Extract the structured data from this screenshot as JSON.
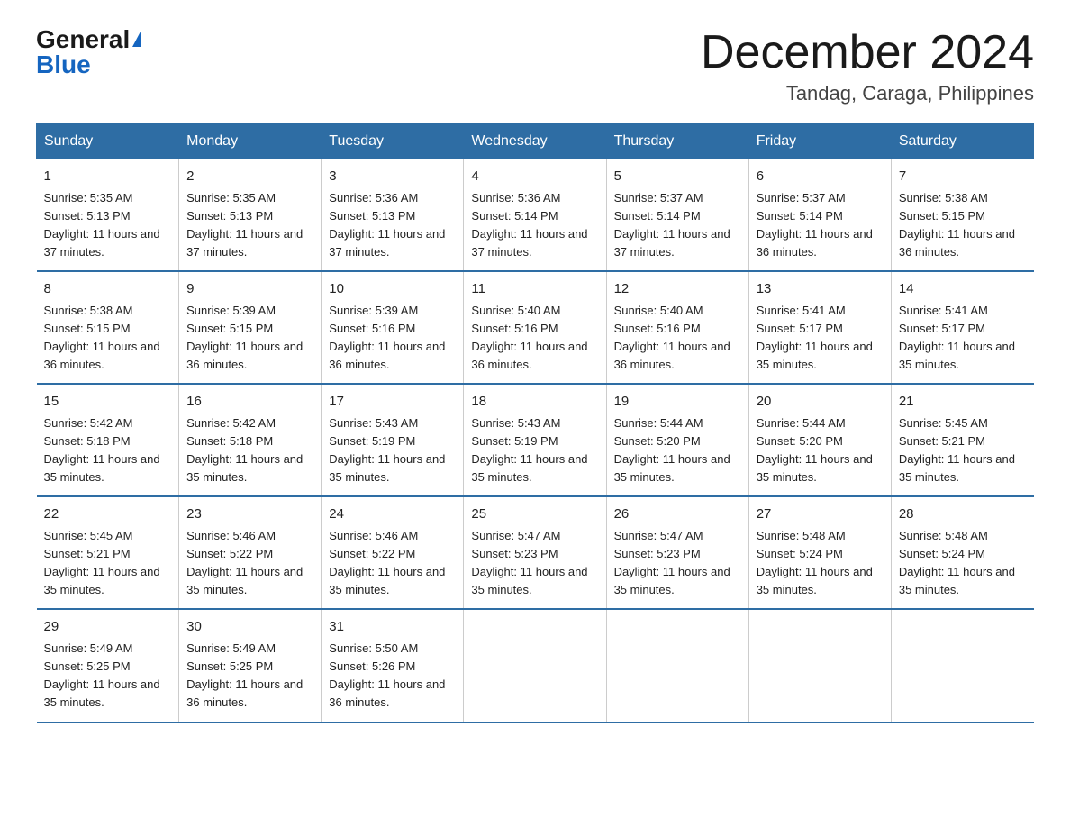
{
  "logo": {
    "text_general": "General",
    "text_blue": "Blue",
    "triangle": "▶"
  },
  "title": {
    "month_year": "December 2024",
    "location": "Tandag, Caraga, Philippines"
  },
  "weekdays": [
    "Sunday",
    "Monday",
    "Tuesday",
    "Wednesday",
    "Thursday",
    "Friday",
    "Saturday"
  ],
  "weeks": [
    [
      {
        "day": "1",
        "sunrise": "5:35 AM",
        "sunset": "5:13 PM",
        "daylight": "11 hours and 37 minutes."
      },
      {
        "day": "2",
        "sunrise": "5:35 AM",
        "sunset": "5:13 PM",
        "daylight": "11 hours and 37 minutes."
      },
      {
        "day": "3",
        "sunrise": "5:36 AM",
        "sunset": "5:13 PM",
        "daylight": "11 hours and 37 minutes."
      },
      {
        "day": "4",
        "sunrise": "5:36 AM",
        "sunset": "5:14 PM",
        "daylight": "11 hours and 37 minutes."
      },
      {
        "day": "5",
        "sunrise": "5:37 AM",
        "sunset": "5:14 PM",
        "daylight": "11 hours and 37 minutes."
      },
      {
        "day": "6",
        "sunrise": "5:37 AM",
        "sunset": "5:14 PM",
        "daylight": "11 hours and 36 minutes."
      },
      {
        "day": "7",
        "sunrise": "5:38 AM",
        "sunset": "5:15 PM",
        "daylight": "11 hours and 36 minutes."
      }
    ],
    [
      {
        "day": "8",
        "sunrise": "5:38 AM",
        "sunset": "5:15 PM",
        "daylight": "11 hours and 36 minutes."
      },
      {
        "day": "9",
        "sunrise": "5:39 AM",
        "sunset": "5:15 PM",
        "daylight": "11 hours and 36 minutes."
      },
      {
        "day": "10",
        "sunrise": "5:39 AM",
        "sunset": "5:16 PM",
        "daylight": "11 hours and 36 minutes."
      },
      {
        "day": "11",
        "sunrise": "5:40 AM",
        "sunset": "5:16 PM",
        "daylight": "11 hours and 36 minutes."
      },
      {
        "day": "12",
        "sunrise": "5:40 AM",
        "sunset": "5:16 PM",
        "daylight": "11 hours and 36 minutes."
      },
      {
        "day": "13",
        "sunrise": "5:41 AM",
        "sunset": "5:17 PM",
        "daylight": "11 hours and 35 minutes."
      },
      {
        "day": "14",
        "sunrise": "5:41 AM",
        "sunset": "5:17 PM",
        "daylight": "11 hours and 35 minutes."
      }
    ],
    [
      {
        "day": "15",
        "sunrise": "5:42 AM",
        "sunset": "5:18 PM",
        "daylight": "11 hours and 35 minutes."
      },
      {
        "day": "16",
        "sunrise": "5:42 AM",
        "sunset": "5:18 PM",
        "daylight": "11 hours and 35 minutes."
      },
      {
        "day": "17",
        "sunrise": "5:43 AM",
        "sunset": "5:19 PM",
        "daylight": "11 hours and 35 minutes."
      },
      {
        "day": "18",
        "sunrise": "5:43 AM",
        "sunset": "5:19 PM",
        "daylight": "11 hours and 35 minutes."
      },
      {
        "day": "19",
        "sunrise": "5:44 AM",
        "sunset": "5:20 PM",
        "daylight": "11 hours and 35 minutes."
      },
      {
        "day": "20",
        "sunrise": "5:44 AM",
        "sunset": "5:20 PM",
        "daylight": "11 hours and 35 minutes."
      },
      {
        "day": "21",
        "sunrise": "5:45 AM",
        "sunset": "5:21 PM",
        "daylight": "11 hours and 35 minutes."
      }
    ],
    [
      {
        "day": "22",
        "sunrise": "5:45 AM",
        "sunset": "5:21 PM",
        "daylight": "11 hours and 35 minutes."
      },
      {
        "day": "23",
        "sunrise": "5:46 AM",
        "sunset": "5:22 PM",
        "daylight": "11 hours and 35 minutes."
      },
      {
        "day": "24",
        "sunrise": "5:46 AM",
        "sunset": "5:22 PM",
        "daylight": "11 hours and 35 minutes."
      },
      {
        "day": "25",
        "sunrise": "5:47 AM",
        "sunset": "5:23 PM",
        "daylight": "11 hours and 35 minutes."
      },
      {
        "day": "26",
        "sunrise": "5:47 AM",
        "sunset": "5:23 PM",
        "daylight": "11 hours and 35 minutes."
      },
      {
        "day": "27",
        "sunrise": "5:48 AM",
        "sunset": "5:24 PM",
        "daylight": "11 hours and 35 minutes."
      },
      {
        "day": "28",
        "sunrise": "5:48 AM",
        "sunset": "5:24 PM",
        "daylight": "11 hours and 35 minutes."
      }
    ],
    [
      {
        "day": "29",
        "sunrise": "5:49 AM",
        "sunset": "5:25 PM",
        "daylight": "11 hours and 35 minutes."
      },
      {
        "day": "30",
        "sunrise": "5:49 AM",
        "sunset": "5:25 PM",
        "daylight": "11 hours and 36 minutes."
      },
      {
        "day": "31",
        "sunrise": "5:50 AM",
        "sunset": "5:26 PM",
        "daylight": "11 hours and 36 minutes."
      },
      null,
      null,
      null,
      null
    ]
  ]
}
